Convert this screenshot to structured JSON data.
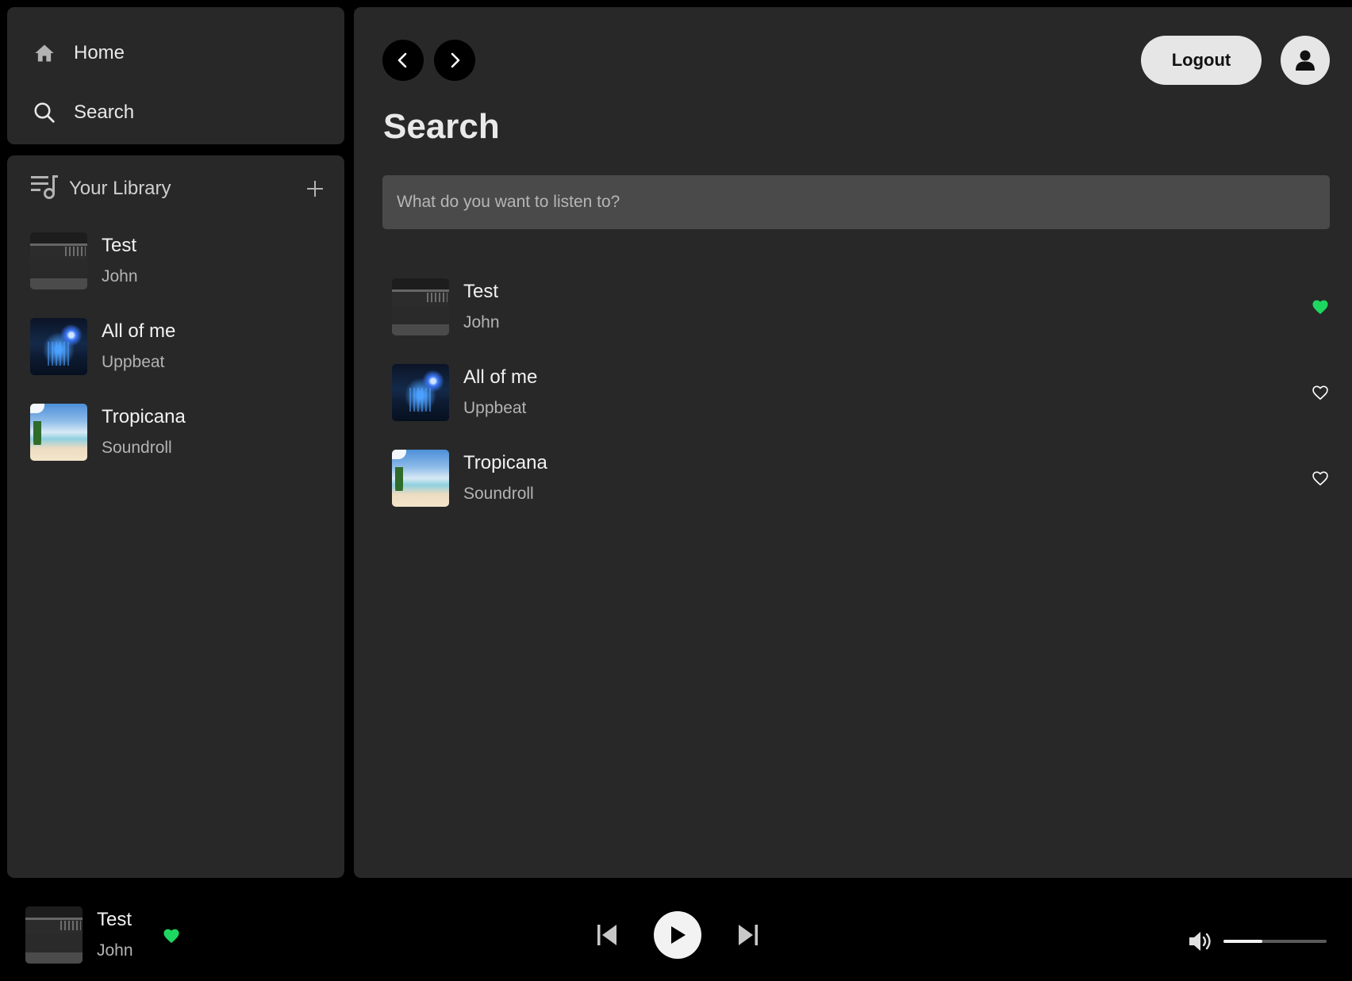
{
  "sidebar": {
    "nav": [
      {
        "label": "Home",
        "icon": "home-icon"
      },
      {
        "label": "Search",
        "icon": "search-icon"
      }
    ],
    "library": {
      "title": "Your Library",
      "icon": "library-icon",
      "add_icon": "plus-icon",
      "items": [
        {
          "title": "Test",
          "artist": "John",
          "cover": "test"
        },
        {
          "title": "All of me",
          "artist": "Uppbeat",
          "cover": "night"
        },
        {
          "title": "Tropicana",
          "artist": "Soundroll",
          "cover": "beach"
        }
      ]
    }
  },
  "header": {
    "back_icon": "chevron-left-icon",
    "forward_icon": "chevron-right-icon",
    "logout_label": "Logout",
    "profile_icon": "user-icon"
  },
  "main": {
    "title": "Search",
    "search_placeholder": "What do you want to listen to?",
    "search_value": "",
    "results": [
      {
        "title": "Test",
        "artist": "John",
        "cover": "test",
        "liked": true
      },
      {
        "title": "All of me",
        "artist": "Uppbeat",
        "cover": "night",
        "liked": false
      },
      {
        "title": "Tropicana",
        "artist": "Soundroll",
        "cover": "beach",
        "liked": false
      }
    ]
  },
  "player": {
    "now_playing": {
      "title": "Test",
      "artist": "John",
      "liked": true
    },
    "controls": {
      "prev_icon": "skip-previous-icon",
      "play_icon": "play-icon",
      "next_icon": "skip-next-icon"
    },
    "volume": {
      "icon": "volume-icon",
      "level": 0.38
    }
  },
  "colors": {
    "accent_green": "#1ed760",
    "panel": "#282828",
    "background": "#000000"
  }
}
